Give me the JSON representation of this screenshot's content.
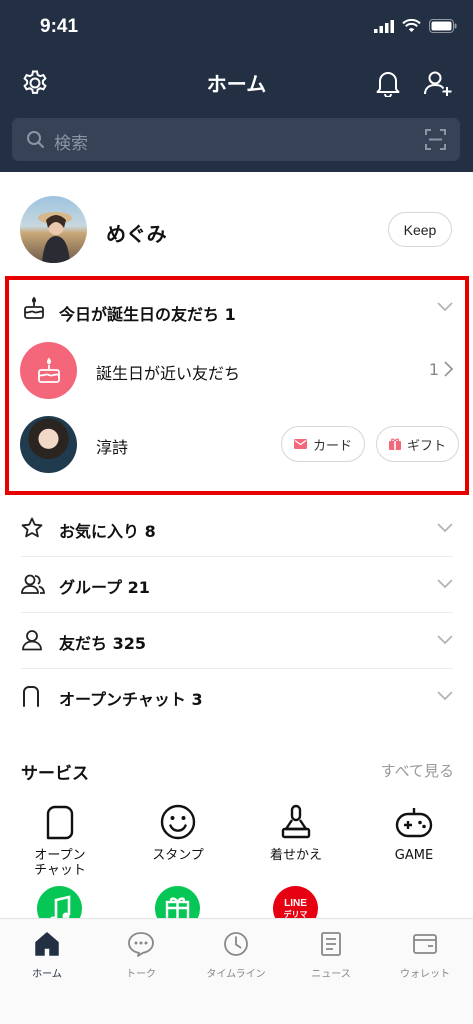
{
  "status_bar": {
    "time": "9:41"
  },
  "header": {
    "title": "ホーム"
  },
  "search": {
    "placeholder": "検索"
  },
  "profile": {
    "name": "めぐみ",
    "keep_label": "Keep"
  },
  "birthday": {
    "title": "今日が誕生日の友だち 1",
    "near_label": "誕生日が近い友だち",
    "near_count": "1",
    "friend_name": "淳詩",
    "card_label": "カード",
    "gift_label": "ギフト"
  },
  "lists": [
    {
      "label": "お気に入り 8",
      "icon": "star-icon"
    },
    {
      "label": "グループ 21",
      "icon": "group-icon"
    },
    {
      "label": "友だち 325",
      "icon": "friend-icon"
    },
    {
      "label": "オープンチャット 3",
      "icon": "openchat-icon"
    }
  ],
  "services": {
    "title": "サービス",
    "see_all": "すべて見る",
    "items": [
      {
        "label": "オープン\nチャット",
        "icon": "openchat-icon"
      },
      {
        "label": "スタンプ",
        "icon": "smiley-icon"
      },
      {
        "label": "着せかえ",
        "icon": "brush-icon"
      },
      {
        "label": "GAME",
        "icon": "gamepad-icon"
      }
    ],
    "second_row": [
      {
        "icon": "music-icon",
        "color": "#06c755"
      },
      {
        "icon": "gift-box-icon",
        "color": "#06c755"
      },
      {
        "icon": "line-delima-icon",
        "color": "#e60012",
        "text": "LINE\nデリマ"
      }
    ]
  },
  "tabs": [
    {
      "label": "ホーム",
      "icon": "home-icon"
    },
    {
      "label": "トーク",
      "icon": "chat-icon"
    },
    {
      "label": "タイムライン",
      "icon": "clock-icon"
    },
    {
      "label": "ニュース",
      "icon": "news-icon"
    },
    {
      "label": "ウォレット",
      "icon": "wallet-icon"
    }
  ],
  "colors": {
    "header_bg": "#233044",
    "accent_red": "#f4677b",
    "line_green": "#06c755",
    "highlight_frame": "#e80000"
  }
}
